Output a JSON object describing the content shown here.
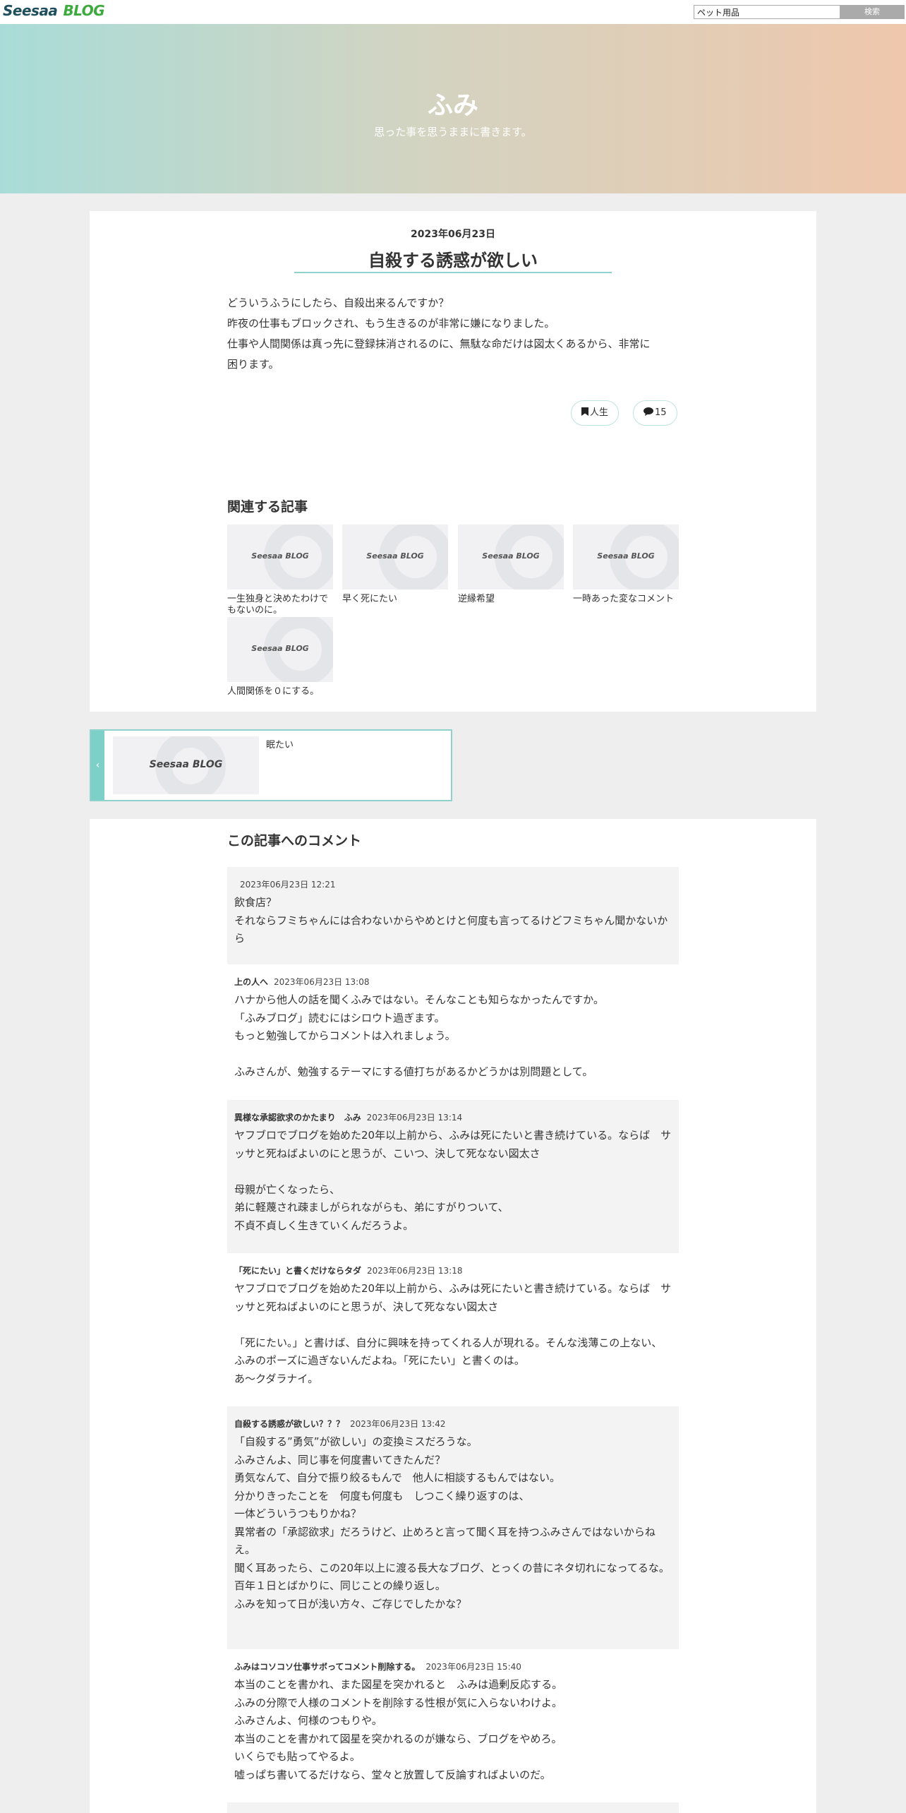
{
  "site": {
    "logo_part1": "Seesaa",
    "logo_part2": "BLOG",
    "search_value": "ペット用品",
    "search_button": "検索"
  },
  "blog": {
    "title": "ふみ",
    "tagline": "思った事を思うままに書きます。"
  },
  "post": {
    "date": "2023年06月23日",
    "title": "自殺する誘惑が欲しい",
    "body": [
      "どういうふうにしたら、自殺出来るんですか？",
      "昨夜の仕事もブロックされ、もう生きるのが非常に嫌になりました。",
      "仕事や人間関係は真っ先に登録抹消されるのに、無駄な命だけは図太くあるから、非常に",
      "困ります。"
    ],
    "category": "人生",
    "comment_count": "15",
    "category_icon": "bookmark-icon",
    "comment_icon": "speech-bubble-icon"
  },
  "related": {
    "heading": "関連する記事",
    "thumb_text": "Seesaa BLOG",
    "items": [
      "一生独身と決めたわけでもないのに。",
      "早く死にたい",
      "逆縁希望",
      "一時あった変なコメント",
      "人間関係を０にする。"
    ]
  },
  "prev": {
    "arrow": "‹",
    "thumb_text": "Seesaa BLOG",
    "title": "眠たい"
  },
  "comments": {
    "heading": "この記事へのコメント",
    "items": [
      {
        "author": "",
        "date": "2023年06月23日 12:21",
        "body": "飲食店？\nそれならフミちゃんには合わないからやめとけと何度も言ってるけどフミちゃん聞かないから"
      },
      {
        "author": "上の人へ",
        "date": "2023年06月23日 13:08",
        "body": "ハナから他人の話を聞くふみではない。そんなことも知らなかったんですか。\n「ふみブログ」読むにはシロウト過ぎます。\nもっと勉強してからコメントは入れましょう。\n\nふみさんが、勉強するテーマにする値打ちがあるかどうかは別問題として。"
      },
      {
        "author": "異様な承認欲求のかたまり　ふみ",
        "date": "2023年06月23日 13:14",
        "body": "ヤフブロでブログを始めた20年以上前から、ふみは死にたいと書き続けている。ならば　サッサと死ねばよいのにと思うが、こいつ、決して死なない図太さ\n\n母親が亡くなったら、\n弟に軽蔑され疎ましがられながらも、弟にすがりついて、\n不貞不貞しく生きていくんだろうよ。"
      },
      {
        "author": "「死にたい」と書くだけならタダ",
        "date": "2023年06月23日 13:18",
        "body": "ヤフブロでブログを始めた20年以上前から、ふみは死にたいと書き続けている。ならば　サッサと死ねばよいのにと思うが、決して死なない図太さ\n\n「死にたい。」と書けば、自分に興味を持ってくれる人が現れる。そんな浅薄この上ない、ふみのポーズに過ぎないんだよね。「死にたい」と書くのは。\nあ〜クダラナイ。"
      },
      {
        "author": "自殺する誘惑が欲しい？？？",
        "date": "2023年06月23日 13:42",
        "body": "「自殺する”勇気”が欲しい」の変換ミスだろうな。\nふみさんよ、同じ事を何度書いてきたんだ？\n勇気なんて、自分で振り絞るもんで　他人に相談するもんではない。\n分かりきったことを　何度も何度も　しつこく繰り返すのは、\n一体どういうつもりかね？\n異常者の「承認欲求」だろうけど、止めろと言って聞く耳を持つふみさんではないからねえ。\n聞く耳あったら、この20年以上に渡る長大なブログ、とっくの昔にネタ切れになってるな。\n百年１日とばかりに、同じことの繰り返し。\nふみを知って日が浅い方々、ご存じでしたかな？"
      },
      {
        "author": "ふみはコソコソ仕事サボってコメント削除する。",
        "date": "2023年06月23日 15:40",
        "body": "本当のことを書かれ、また図星を突かれると　ふみは過剰反応する。\nふみの分際で人様のコメントを削除する性根が気に入らないわけよ。\nふみさんよ、何様のつもりや。\n本当のことを書かれて図星を突かれるのが嫌なら、ブログをやめろ。\nいくらでも貼ってやるよ。\n嘘っぱち書いてるだけなら、堂々と放置して反論すればよいのだ。"
      }
    ]
  }
}
